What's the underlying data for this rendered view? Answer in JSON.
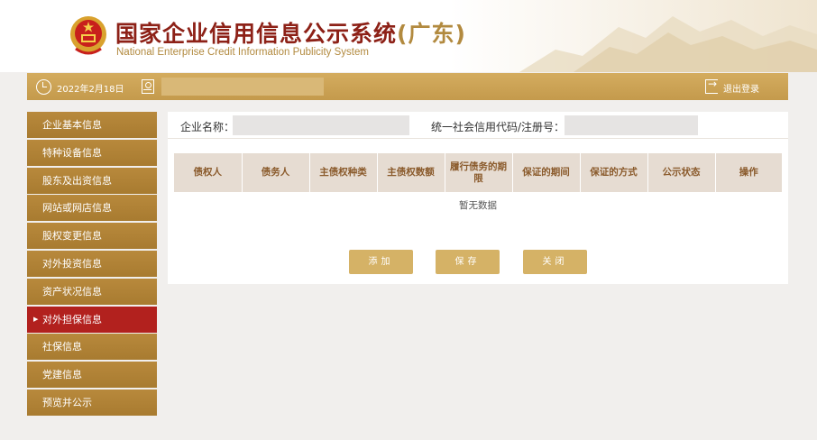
{
  "header": {
    "title": "国家企业信用信息公示系统",
    "province": "(广东)",
    "subtitle": "National Enterprise Credit Information Publicity System"
  },
  "topbar": {
    "date": "2022年2月18日",
    "logout_label": "退出登录"
  },
  "sidebar": {
    "items": [
      {
        "label": "企业基本信息"
      },
      {
        "label": "特种设备信息"
      },
      {
        "label": "股东及出资信息"
      },
      {
        "label": "网站或网店信息"
      },
      {
        "label": "股权变更信息"
      },
      {
        "label": "对外投资信息"
      },
      {
        "label": "资产状况信息"
      },
      {
        "label": "对外担保信息",
        "active": true
      },
      {
        "label": "社保信息"
      },
      {
        "label": "党建信息"
      },
      {
        "label": "预览并公示"
      }
    ]
  },
  "main": {
    "company_name_label": "企业名称：",
    "credit_code_label": "统一社会信用代码/注册号：",
    "table": {
      "columns": [
        "债权人",
        "债务人",
        "主债权种类",
        "主债权数额",
        "履行债务的期限",
        "保证的期间",
        "保证的方式",
        "公示状态",
        "操作"
      ],
      "empty_text": "暂无数据"
    },
    "buttons": {
      "add": "添加",
      "save": "保存",
      "close": "关闭"
    }
  },
  "colors": {
    "brand_red": "#8d2117",
    "gold": "#c49a4c",
    "sidebar_active": "#b2211e",
    "button": "#d5b266"
  }
}
